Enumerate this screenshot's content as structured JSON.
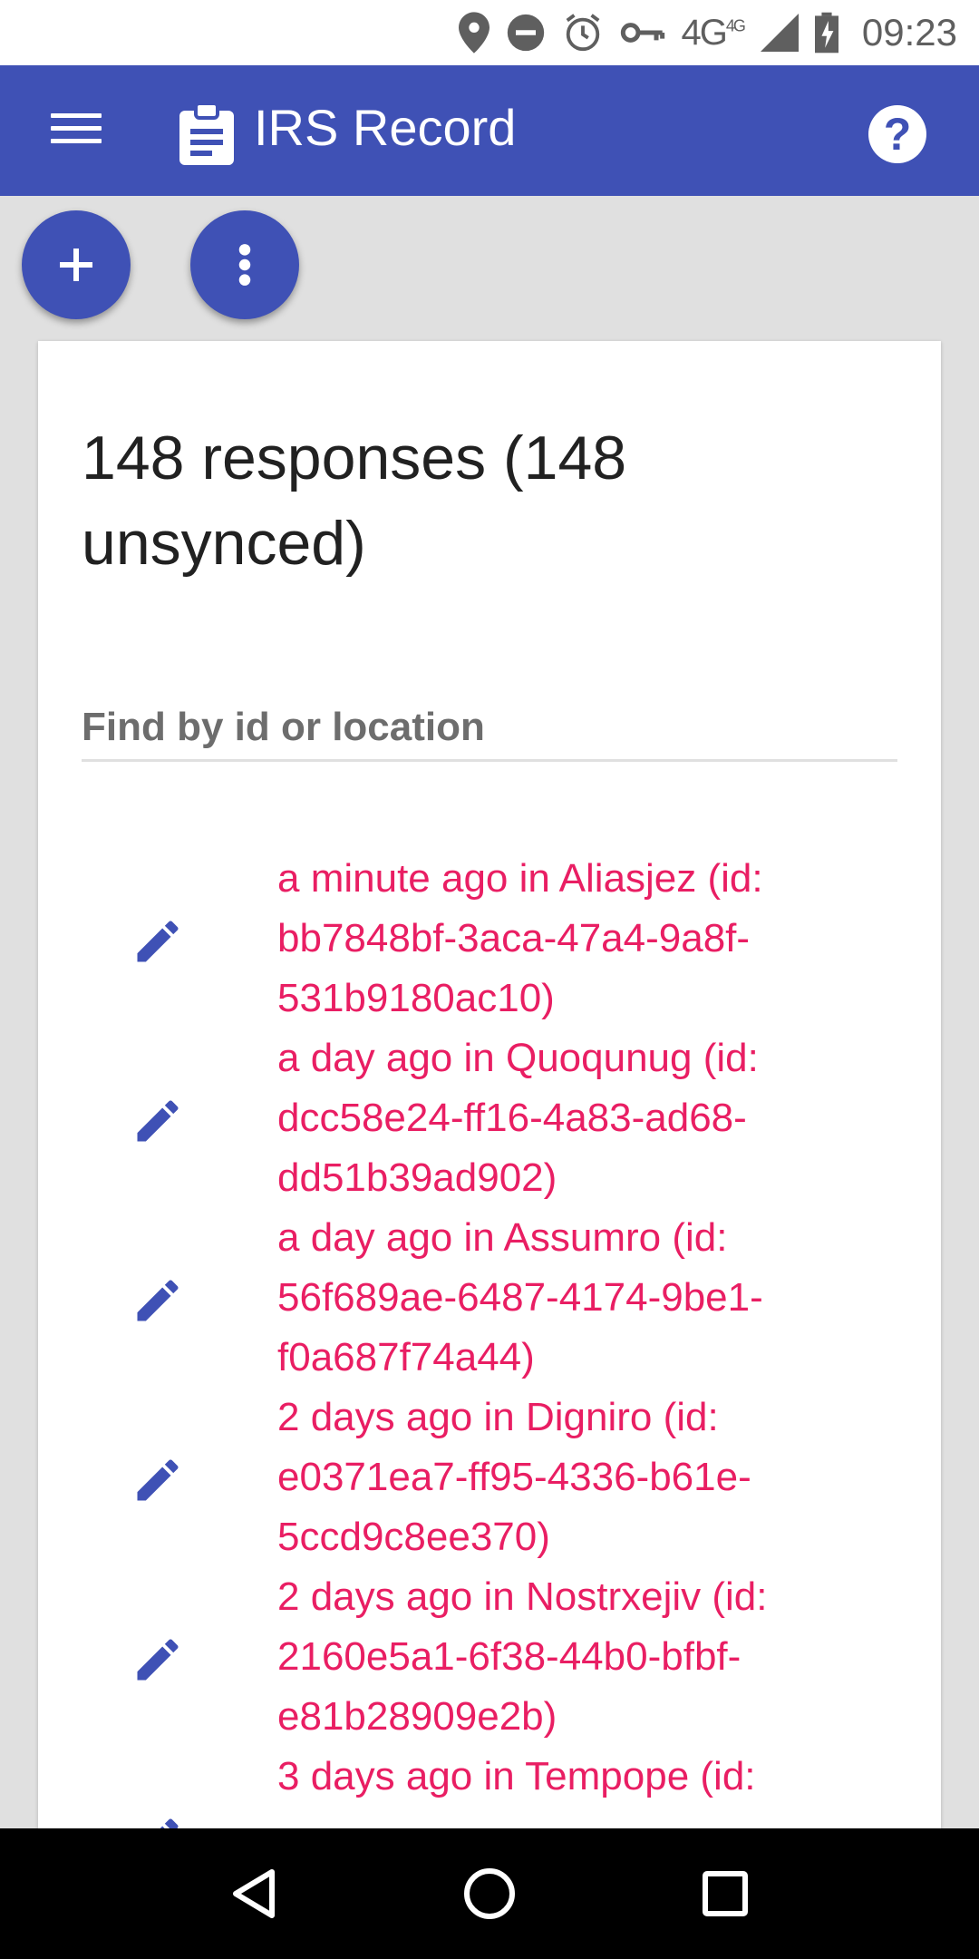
{
  "status_bar": {
    "time": "09:23",
    "network": "4G",
    "network_sup": "4G",
    "icons": [
      "location-icon",
      "do-not-disturb-icon",
      "alarm-icon",
      "vpn-key-icon",
      "signal-icon",
      "battery-icon"
    ]
  },
  "app_bar": {
    "title": "IRS Record",
    "color": "#3f51b5"
  },
  "summary": {
    "title": "148 responses (148 unsynced)"
  },
  "search": {
    "placeholder": "Find by id or location",
    "value": ""
  },
  "responses": [
    {
      "text": "a minute ago in Aliasjez (id: bb7848bf-3aca-47a4-9a8f-531b9180ac10)"
    },
    {
      "text": "a day ago in Quoqunug (id: dcc58e24-ff16-4a83-ad68-dd51b39ad902)"
    },
    {
      "text": "a day ago in Assumro (id: 56f689ae-6487-4174-9be1-f0a687f74a44)"
    },
    {
      "text": "2 days ago in Digniro (id: e0371ea7-ff95-4336-b61e-5ccd9c8ee370)"
    },
    {
      "text": "2 days ago in Nostrxejiv (id: 2160e5a1-6f38-44b0-bfbf-e81b28909e2b)"
    },
    {
      "text": "3 days ago in Tempope (id: "
    }
  ],
  "colors": {
    "accent": "#3f51b5",
    "link_text": "#e91e63"
  }
}
